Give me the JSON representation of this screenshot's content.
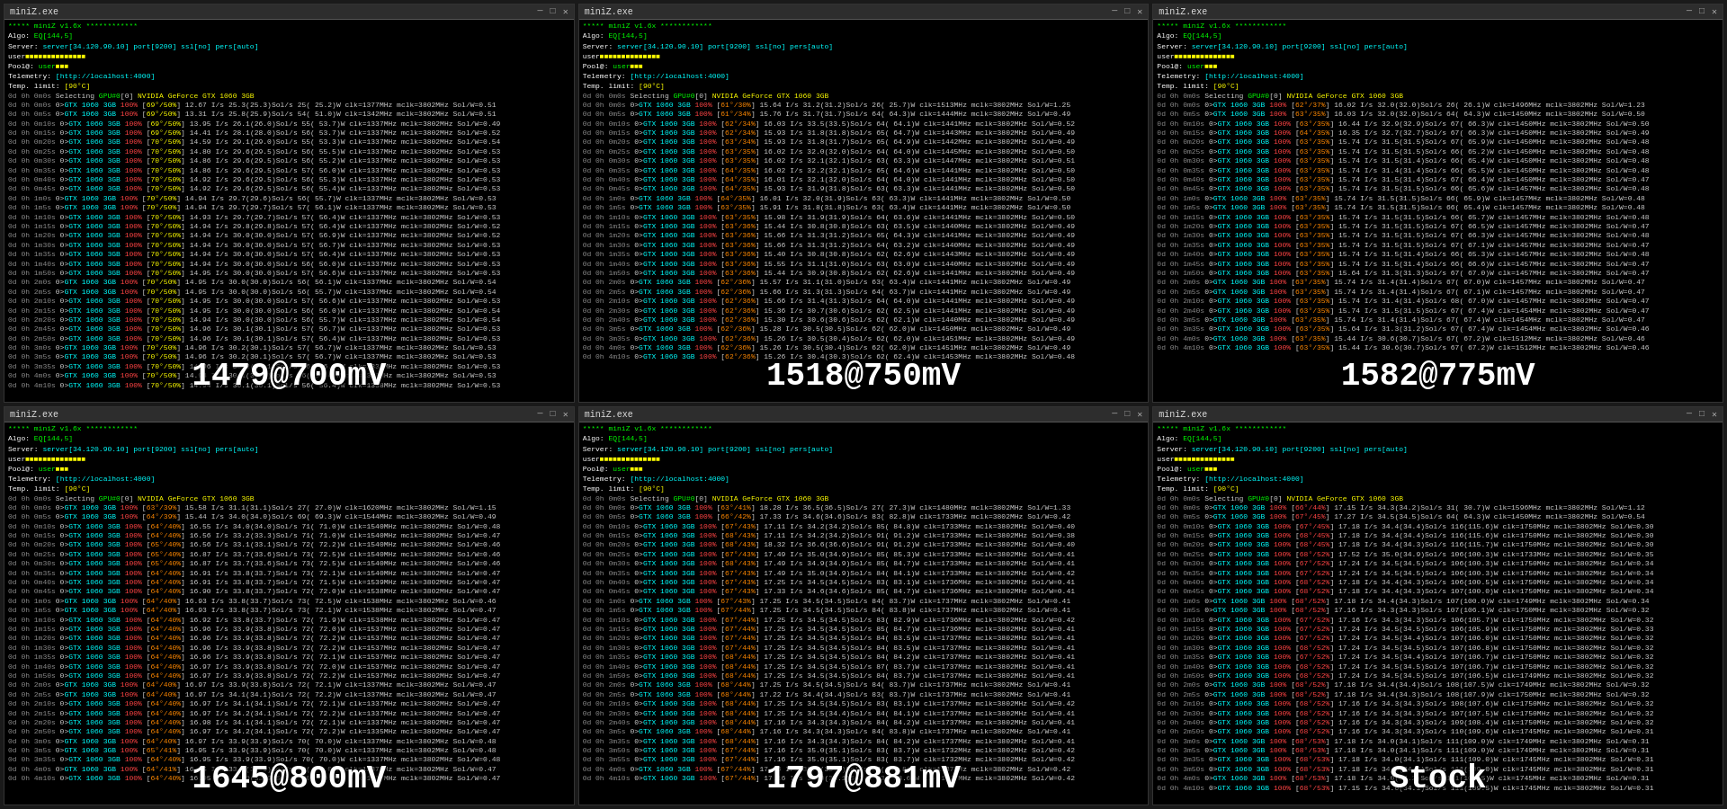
{
  "panels": [
    {
      "id": "panel-1",
      "title": "miniZ.exe",
      "label": "1479@700mV",
      "algo": "EQ[144,5]",
      "server": "server[34.120.90.10] port[9200] ssl[no] pers[auto]",
      "user": "user[■■■■■■■■■■■■■■■■]",
      "telemetry": "[http://localhost:4000]",
      "temp_limit": "[90°C]",
      "gpu_info": "NVIDIA GeForce GTX 1060 3GB",
      "hashrate_label": "1479@700mV"
    },
    {
      "id": "panel-2",
      "title": "miniZ.exe",
      "label": "1518@750mV",
      "algo": "EQ[144,5]",
      "server": "server[34.120.90.10] port[9200] ssl[no] pers[auto]",
      "user": "user[■■■■■■■■■■■■■■■■]",
      "telemetry": "[http://localhost:4000]",
      "temp_limit": "[90°C]",
      "gpu_info": "NVIDIA GeForce GTX 1060 3GB",
      "hashrate_label": "1518@750mV"
    },
    {
      "id": "panel-3",
      "title": "miniZ.exe",
      "label": "1582@775mV",
      "algo": "EQ[144,5]",
      "server": "server[34.120.90.10] port[9200] ssl[no] pers[auto]",
      "user": "user[■■■■■■■■■■■■■■■■]",
      "telemetry": "[http://localhost:4000]",
      "temp_limit": "[90°C]",
      "gpu_info": "NVIDIA GeForce GTX 1060 3GB",
      "hashrate_label": "1582@775mV"
    },
    {
      "id": "panel-4",
      "title": "miniZ.exe",
      "label": "1645@800mV",
      "algo": "EQ[144,5]",
      "server": "server[34.120.90.10] port[9200] ssl[no] pers[auto]",
      "user": "user[■■■■■■■■■■■■■■■■]",
      "telemetry": "[http://localhost:4000]",
      "temp_limit": "[90°C]",
      "gpu_info": "NVIDIA GeForce GTX 1060 3GB",
      "hashrate_label": "1645@800mV"
    },
    {
      "id": "panel-5",
      "title": "miniZ.exe",
      "label": "1797@881mV",
      "algo": "EQ[144,5]",
      "server": "server[34.120.90.10] port[9200] ssl[no] pers[auto]",
      "user": "user[■■■■■■■■■■■■■■■■]",
      "telemetry": "[http://localhost:4000]",
      "temp_limit": "[90°C]",
      "gpu_info": "NVIDIA GeForce GTX 1060 3GB",
      "hashrate_label": "1797@881mV"
    },
    {
      "id": "panel-6",
      "title": "miniZ.exe",
      "label": "Stock",
      "algo": "EQ[144,5]",
      "server": "server[34.120.90.10] port[9200] ssl[no] pers[auto]",
      "user": "user[■■■■■■■■■■■■■■■■]",
      "telemetry": "[http://localhost:4000]",
      "temp_limit": "[90°C]",
      "gpu_info": "NVIDIA GeForce GTX 1060 3GB",
      "hashrate_label": "Stock"
    }
  ]
}
